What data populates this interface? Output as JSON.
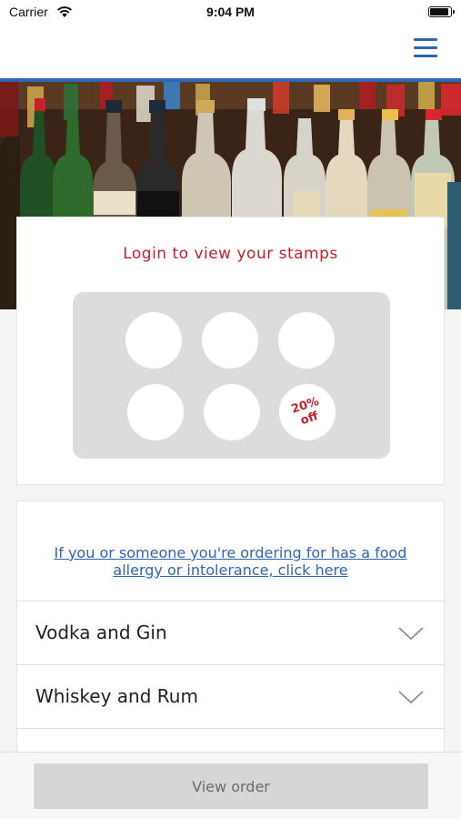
{
  "status_bar": {
    "carrier": "Carrier",
    "time": "9:04 PM",
    "wifi_icon": "wifi-icon",
    "battery_icon": "battery-icon"
  },
  "nav": {
    "menu_icon": "hamburger-menu-icon",
    "accent_color": "#2f66b6"
  },
  "hero": {
    "image": "liquor-bottles-shelf"
  },
  "stamp_card": {
    "title": "Login to view your stamps",
    "title_color": "#c8202a",
    "stamps": [
      {
        "filled": false
      },
      {
        "filled": false
      },
      {
        "filled": false
      },
      {
        "filled": false
      },
      {
        "filled": false
      },
      {
        "filled": false,
        "reward": "20% off"
      }
    ],
    "reward_line1": "20%",
    "reward_line2": "off"
  },
  "menu": {
    "allergy_link": "If you or someone you're ordering for has a food allergy or intolerance, click here",
    "categories": [
      {
        "label": "Vodka and Gin",
        "icon": "chevron-down-icon"
      },
      {
        "label": "Whiskey and Rum",
        "icon": "chevron-down-icon"
      },
      {
        "label": "",
        "icon": "chevron-down-icon"
      }
    ]
  },
  "footer": {
    "view_order_label": "View order"
  }
}
